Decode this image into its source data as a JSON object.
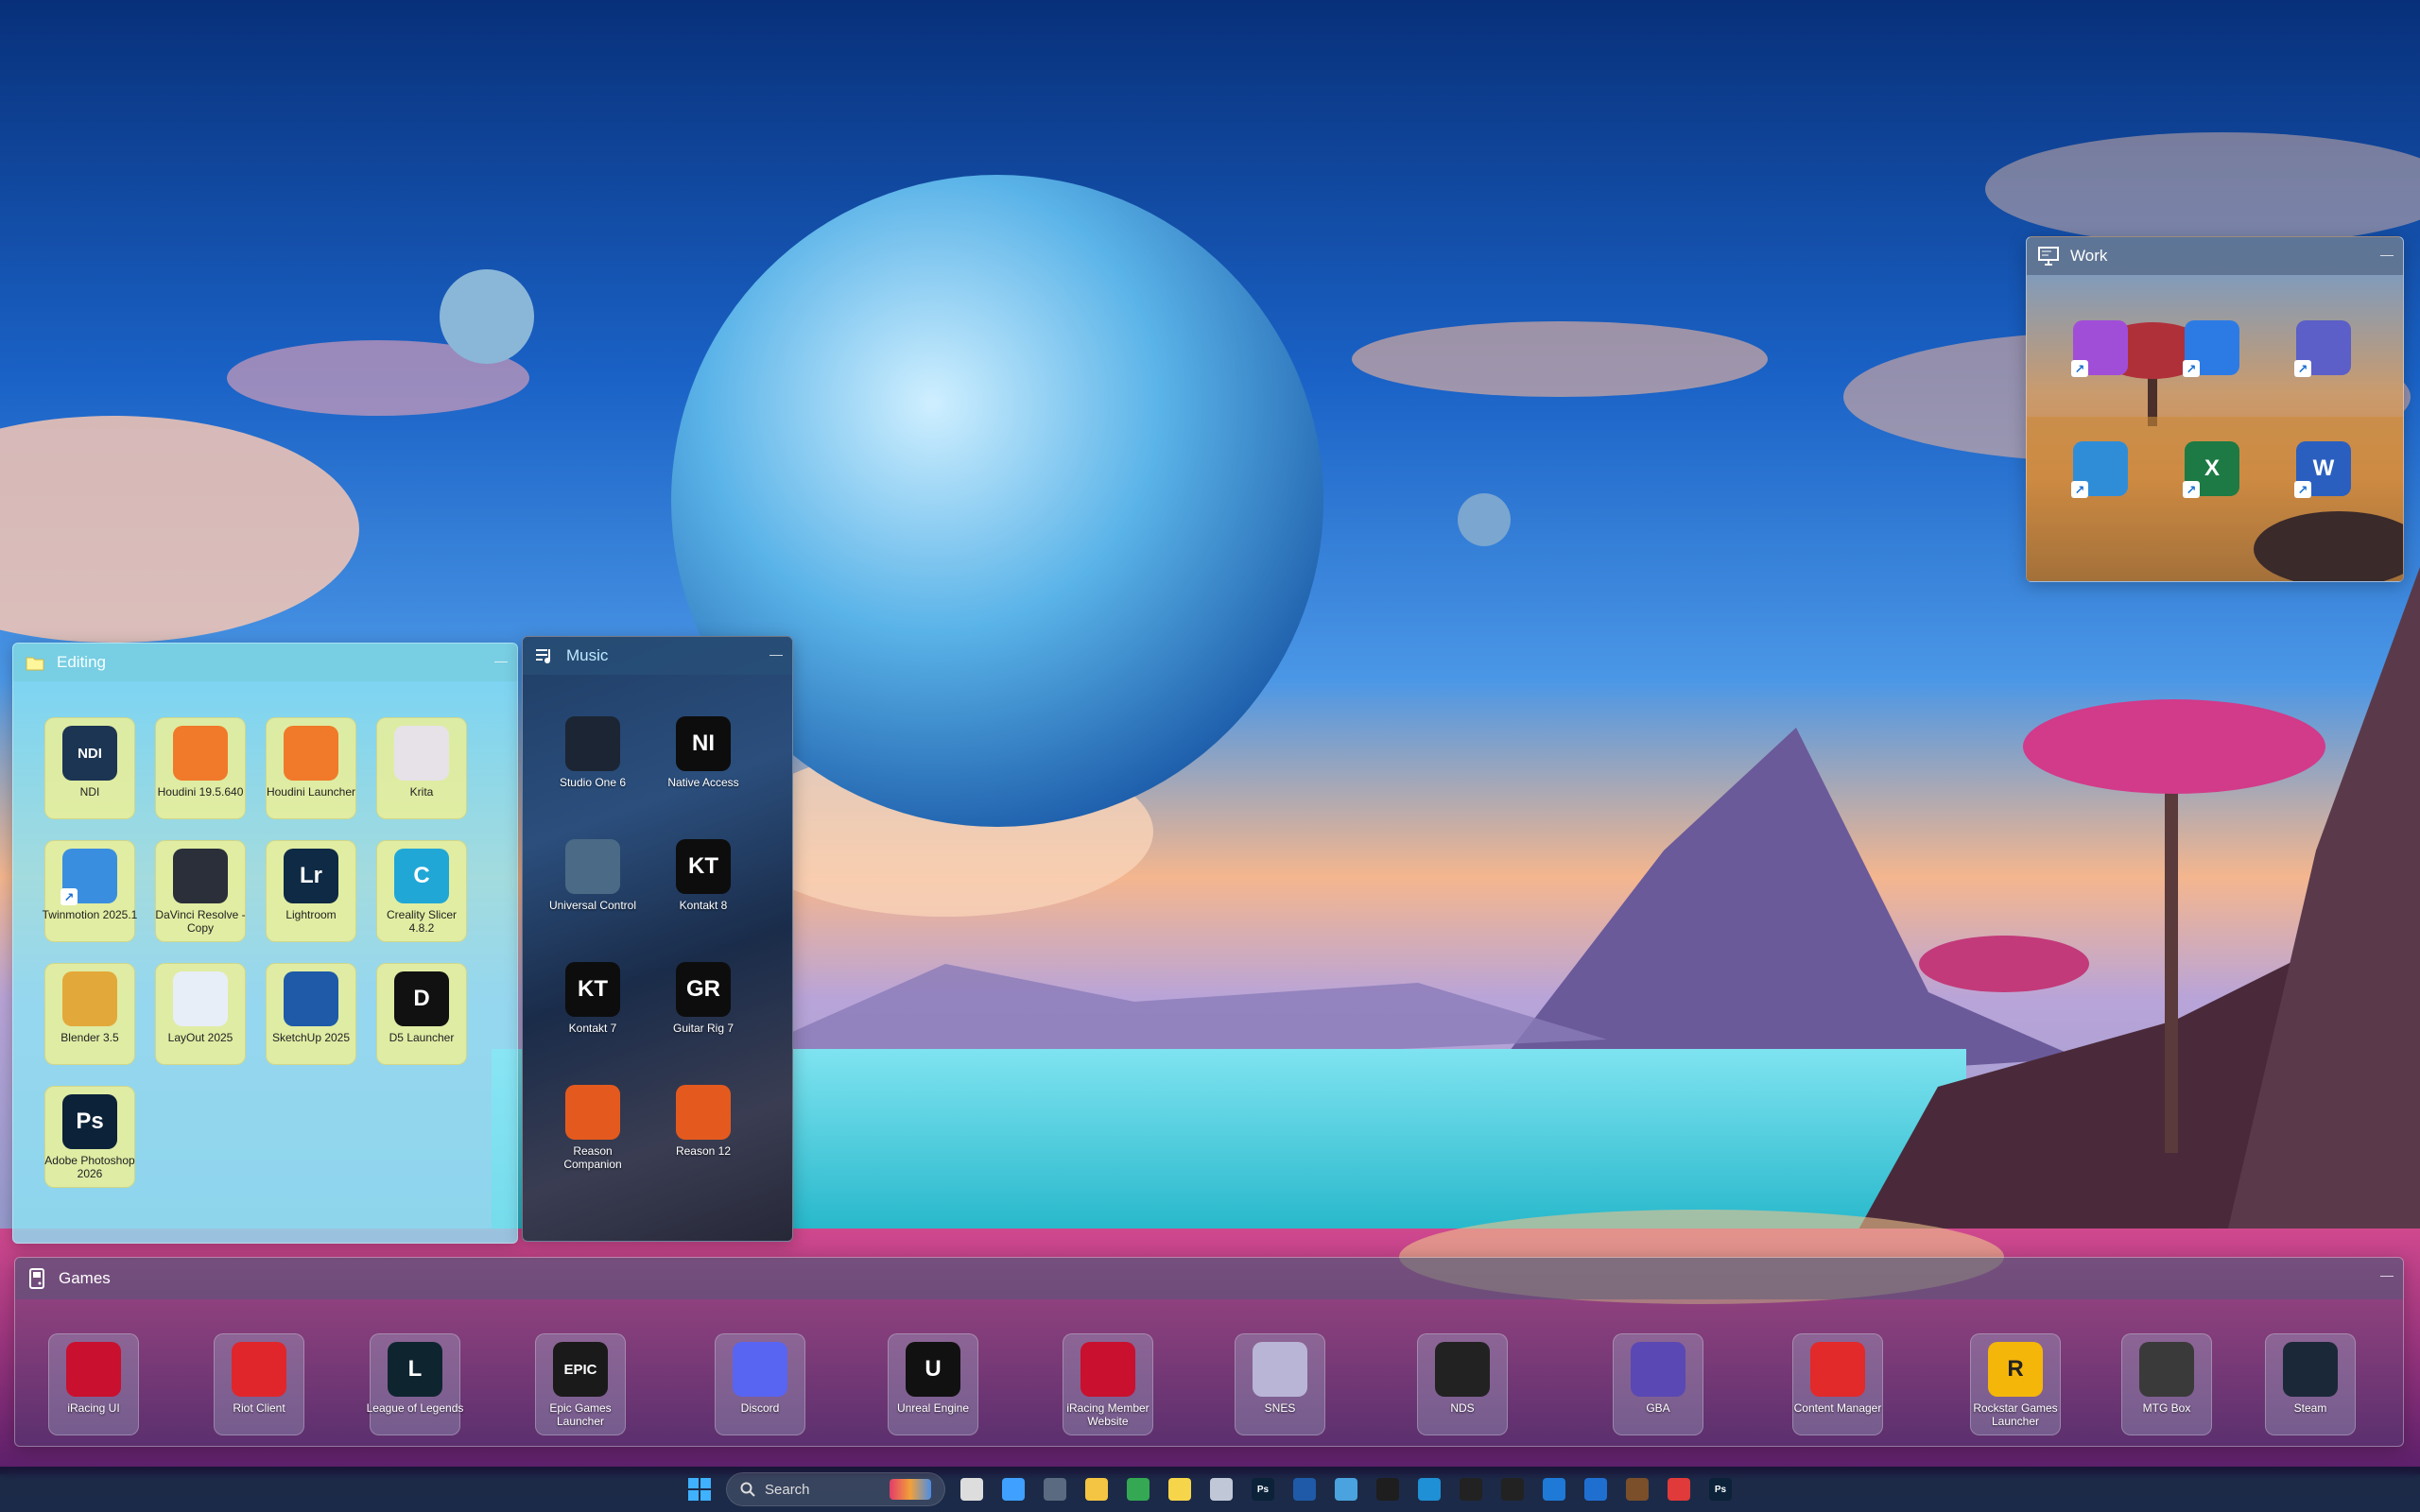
{
  "fences": {
    "editing": {
      "title": "Editing",
      "items": [
        {
          "label": "NDI",
          "icon": "ndi-icon",
          "glyph": "NDI",
          "bg": "#1c3553"
        },
        {
          "label": "Houdini 19.5.640",
          "icon": "houdini-icon",
          "glyph": "",
          "bg": "#f07a2a"
        },
        {
          "label": "Houdini Launcher",
          "icon": "houdini-launcher-icon",
          "glyph": "",
          "bg": "#f07a2a"
        },
        {
          "label": "Krita",
          "icon": "krita-icon",
          "glyph": "",
          "bg": "#e6e2e8"
        },
        {
          "label": "Twinmotion 2025.1",
          "icon": "twinmotion-icon",
          "glyph": "",
          "bg": "#3a8ee0"
        },
        {
          "label": "DaVinci Resolve - Copy",
          "icon": "davinci-resolve-icon",
          "glyph": "",
          "bg": "#2a2f3a"
        },
        {
          "label": "Lightroom",
          "icon": "lightroom-icon",
          "glyph": "Lr",
          "bg": "#0f2a44"
        },
        {
          "label": "Creality Slicer 4.8.2",
          "icon": "creality-slicer-icon",
          "glyph": "C",
          "bg": "#20a7d6"
        },
        {
          "label": "Blender 3.5",
          "icon": "blender-icon",
          "glyph": "",
          "bg": "#e3a83a"
        },
        {
          "label": "LayOut 2025",
          "icon": "layout-icon",
          "glyph": "",
          "bg": "#e8eef8"
        },
        {
          "label": "SketchUp 2025",
          "icon": "sketchup-icon",
          "glyph": "",
          "bg": "#1e5aa8"
        },
        {
          "label": "D5 Launcher",
          "icon": "d5-launcher-icon",
          "glyph": "D",
          "bg": "#111111"
        },
        {
          "label": "Adobe Photoshop 2026",
          "icon": "photoshop-icon",
          "glyph": "Ps",
          "bg": "#0b2239"
        }
      ]
    },
    "music": {
      "title": "Music",
      "items": [
        {
          "label": "Studio One 6",
          "icon": "studio-one-icon",
          "glyph": "",
          "bg": "#1c2533"
        },
        {
          "label": "Native Access",
          "icon": "native-access-icon",
          "glyph": "NI",
          "bg": "#0d0d0d"
        },
        {
          "label": "Universal Control",
          "icon": "universal-control-icon",
          "glyph": "",
          "bg": "#4a6a86"
        },
        {
          "label": "Kontakt 8",
          "icon": "kontakt-8-icon",
          "glyph": "KT",
          "bg": "#0d0d0d"
        },
        {
          "label": "Kontakt 7",
          "icon": "kontakt-7-icon",
          "glyph": "KT",
          "bg": "#0d0d0d"
        },
        {
          "label": "Guitar Rig 7",
          "icon": "guitar-rig-icon",
          "glyph": "GR",
          "bg": "#0d0d0d"
        },
        {
          "label": "Reason Companion",
          "icon": "reason-companion-icon",
          "glyph": "",
          "bg": "#e45a1e"
        },
        {
          "label": "Reason 12",
          "icon": "reason-icon",
          "glyph": "",
          "bg": "#e45a1e"
        }
      ]
    },
    "work": {
      "title": "Work",
      "items": [
        {
          "icon": "microsoft-loop-icon",
          "bg": "#a04ed8"
        },
        {
          "icon": "microsoft-todo-icon",
          "bg": "#2c7be5"
        },
        {
          "icon": "microsoft-teams-icon",
          "bg": "#5b5fc7"
        },
        {
          "icon": "microsoft-planner-icon",
          "bg": "#2f8dd8"
        },
        {
          "icon": "microsoft-excel-icon",
          "glyph": "X",
          "bg": "#1d7a44"
        },
        {
          "icon": "microsoft-word-icon",
          "glyph": "W",
          "bg": "#2b5fbf"
        }
      ]
    },
    "games": {
      "title": "Games",
      "items": [
        {
          "label": "iRacing UI",
          "icon": "iracing-icon",
          "glyph": "",
          "bg": "#c9102f"
        },
        {
          "label": "Riot Client",
          "icon": "riot-client-icon",
          "glyph": "",
          "bg": "#e0262b"
        },
        {
          "label": "League of Legends",
          "icon": "league-of-legends-icon",
          "glyph": "L",
          "bg": "#0e2530"
        },
        {
          "label": "Epic Games Launcher",
          "icon": "epic-games-icon",
          "glyph": "EPIC",
          "bg": "#1a1a1a"
        },
        {
          "label": "Discord",
          "icon": "discord-icon",
          "glyph": "",
          "bg": "#5865f2"
        },
        {
          "label": "Unreal Engine",
          "icon": "unreal-engine-icon",
          "glyph": "U",
          "bg": "#111111"
        },
        {
          "label": "iRacing Member Website",
          "icon": "iracing-website-icon",
          "glyph": "",
          "bg": "#c9102f"
        },
        {
          "label": "SNES",
          "icon": "snes-icon",
          "glyph": "",
          "bg": "#b9b5d6"
        },
        {
          "label": "NDS",
          "icon": "nds-icon",
          "glyph": "",
          "bg": "#222222"
        },
        {
          "label": "GBA",
          "icon": "gba-icon",
          "glyph": "",
          "bg": "#5a48b5"
        },
        {
          "label": "Content Manager",
          "icon": "content-manager-icon",
          "glyph": "",
          "bg": "#e22a2a"
        },
        {
          "label": "Rockstar Games Launcher",
          "icon": "rockstar-icon",
          "glyph": "R",
          "bg": "#f5b60a"
        },
        {
          "label": "MTG Box",
          "icon": "mtg-box-icon",
          "glyph": "",
          "bg": "#3a3a3a"
        },
        {
          "label": "Steam",
          "icon": "steam-icon",
          "glyph": "",
          "bg": "#1b2838"
        }
      ]
    }
  },
  "taskbar": {
    "search_label": "Search",
    "pinned": [
      {
        "icon": "task-view-icon",
        "bg": "#dddddd"
      },
      {
        "icon": "copilot-icon",
        "bg": "#3fa0ff"
      },
      {
        "icon": "calculator-icon",
        "bg": "#5a6a80"
      },
      {
        "icon": "file-explorer-icon",
        "bg": "#f4c542"
      },
      {
        "icon": "chrome-icon",
        "bg": "#34a853"
      },
      {
        "icon": "sticky-notes-icon",
        "bg": "#f7d54a"
      },
      {
        "icon": "phone-link-icon",
        "bg": "#c0c8d8"
      },
      {
        "icon": "photoshop-taskbar-icon",
        "glyph": "Ps",
        "bg": "#0b2239"
      },
      {
        "icon": "sketchup-taskbar-icon",
        "bg": "#1e5aa8"
      },
      {
        "icon": "notepad-icon",
        "bg": "#4aa3df"
      },
      {
        "icon": "terminal-icon",
        "bg": "#1e1e1e"
      },
      {
        "icon": "edge-icon",
        "bg": "#1f8fd6"
      },
      {
        "icon": "chatgpt-icon",
        "bg": "#222222"
      },
      {
        "icon": "chatgpt-2-icon",
        "bg": "#222222"
      },
      {
        "icon": "vscode-icon",
        "bg": "#1e7ad6"
      },
      {
        "icon": "outlook-icon",
        "bg": "#1f6fd1"
      },
      {
        "icon": "photo-app-icon",
        "bg": "#7a4f2a"
      },
      {
        "icon": "media-player-icon",
        "bg": "#e03a3a"
      },
      {
        "icon": "photoshop-taskbar-2-icon",
        "glyph": "Ps",
        "bg": "#0b2239"
      }
    ]
  }
}
